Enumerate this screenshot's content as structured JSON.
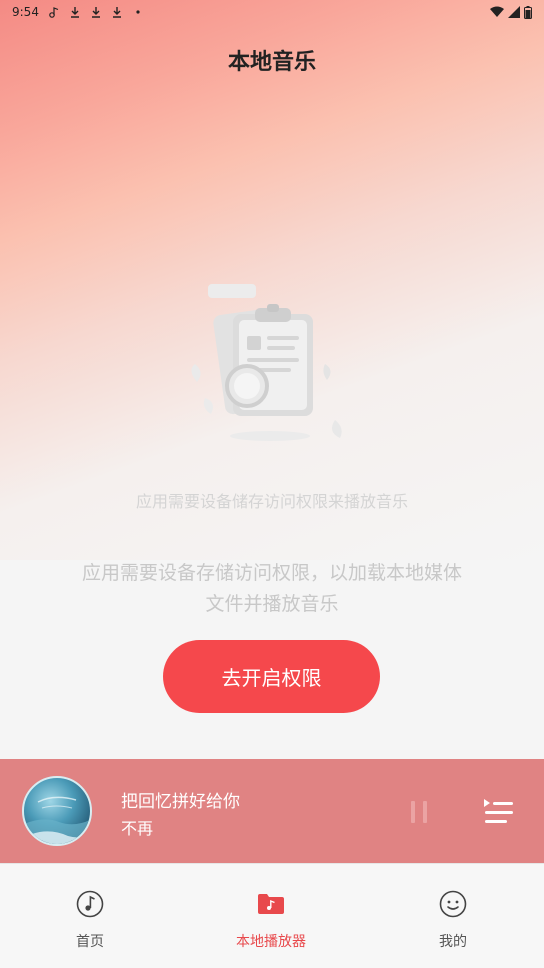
{
  "status_bar": {
    "time": "9:54",
    "icons": [
      "music-notification-icon",
      "download-icon",
      "download-icon",
      "download-icon",
      "dot-icon"
    ],
    "right_icons": [
      "wifi-icon",
      "cell-signal-icon",
      "battery-icon"
    ]
  },
  "header": {
    "title": "本地音乐"
  },
  "empty_state": {
    "illustration": "clipboard-search-icon",
    "hint_small": "应用需要设备储存访问权限来播放音乐",
    "hint_main": "应用需要设备存储访问权限，以加载本地媒体文件并播放音乐",
    "button_label": "去开启权限"
  },
  "player": {
    "song_title": "把回忆拼好给你",
    "artist": "不再",
    "state": "paused",
    "controls": [
      "pause-icon",
      "playlist-icon"
    ]
  },
  "bottom_nav": {
    "items": [
      {
        "label": "首页",
        "icon": "music-note-icon",
        "active": false
      },
      {
        "label": "本地播放器",
        "icon": "music-folder-icon",
        "active": true
      },
      {
        "label": "我的",
        "icon": "smiley-icon",
        "active": false
      }
    ]
  },
  "colors": {
    "accent": "#f5484c",
    "player_bg": "#e08383",
    "nav_active": "#e8494c",
    "gradient_top": "#f48a84"
  }
}
